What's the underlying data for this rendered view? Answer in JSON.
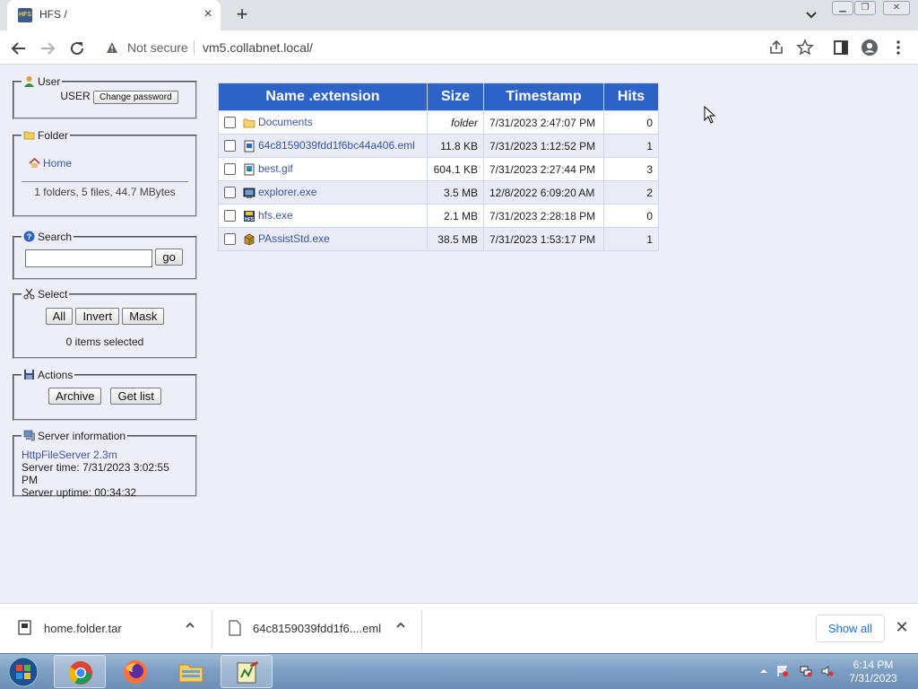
{
  "browser": {
    "tab_title": "HFS /",
    "tab_favicon_text": "HFS",
    "not_secure": "Not secure",
    "url": "vm5.collabnet.local/"
  },
  "sidebar": {
    "user": {
      "legend": "User",
      "username": "USER",
      "change_password": "Change password"
    },
    "folder": {
      "legend": "Folder",
      "home": "Home",
      "summary": "1 folders, 5 files, 44.7 MBytes"
    },
    "search": {
      "legend": "Search",
      "input_value": "",
      "go": "go"
    },
    "select": {
      "legend": "Select",
      "all": "All",
      "invert": "Invert",
      "mask": "Mask",
      "status": "0 items selected"
    },
    "actions": {
      "legend": "Actions",
      "archive": "Archive",
      "get_list": "Get list"
    },
    "server": {
      "legend": "Server information",
      "software": "HttpFileServer 2.3m",
      "time": "Server time: 7/31/2023 3:02:55 PM",
      "uptime": "Server uptime: 00:34:32"
    }
  },
  "table": {
    "headers": [
      "Name .extension",
      "Size",
      "Timestamp",
      "Hits"
    ],
    "rows": [
      {
        "name": "Documents",
        "size": "folder",
        "timestamp": "7/31/2023 2:47:07 PM",
        "hits": "0",
        "icon": "folder-icon"
      },
      {
        "name": "64c8159039fdd1f6bc44a406.eml",
        "size": "11.8 KB",
        "timestamp": "7/31/2023 1:12:52 PM",
        "hits": "1",
        "icon": "eml-file-icon"
      },
      {
        "name": "best.gif",
        "size": "604.1 KB",
        "timestamp": "7/31/2023 2:27:44 PM",
        "hits": "3",
        "icon": "image-file-icon"
      },
      {
        "name": "explorer.exe",
        "size": "3.5 MB",
        "timestamp": "12/8/2022 6:09:20 AM",
        "hits": "2",
        "icon": "explorer-exe-icon"
      },
      {
        "name": "hfs.exe",
        "size": "2.1 MB",
        "timestamp": "7/31/2023 2:28:18 PM",
        "hits": "0",
        "icon": "hfs-exe-icon"
      },
      {
        "name": "PAssistStd.exe",
        "size": "38.5 MB",
        "timestamp": "7/31/2023 1:53:17 PM",
        "hits": "1",
        "icon": "passist-exe-icon"
      }
    ]
  },
  "downloads": {
    "items": [
      {
        "name": "home.folder.tar"
      },
      {
        "name": "64c8159039fdd1f6....eml"
      }
    ],
    "show_all": "Show all"
  },
  "taskbar": {
    "time": "6:14 PM",
    "date": "7/31/2023"
  },
  "colors": {
    "table_header": "#2d63c6",
    "page_background": "#eeeef8",
    "link": "#3b55a8"
  }
}
